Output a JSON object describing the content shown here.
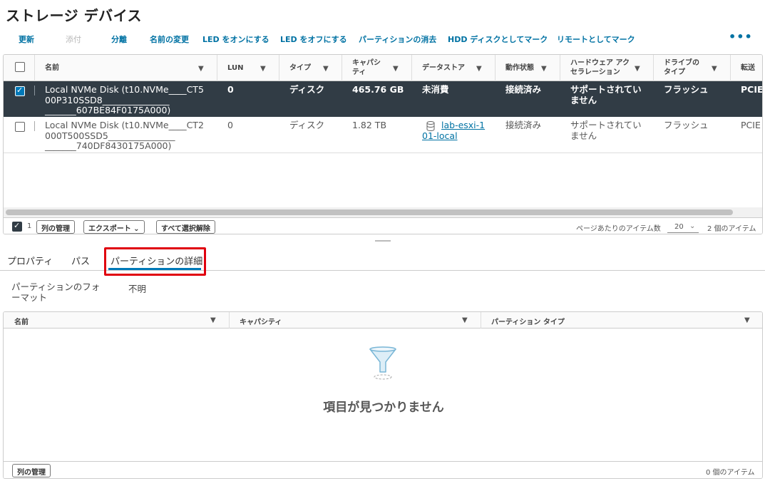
{
  "page": {
    "title": "ストレージ デバイス"
  },
  "toolbar": {
    "refresh": "更新",
    "attach": "添付",
    "detach": "分離",
    "rename": "名前の変更",
    "led_on": "LED をオンにする",
    "led_off": "LED をオフにする",
    "erase_partitions": "パーティションの消去",
    "mark_hdd": "HDD ディスクとしてマーク",
    "mark_remote": "リモートとしてマーク",
    "more": "•••"
  },
  "devices_grid": {
    "columns": {
      "name": "名前",
      "lun": "LUN",
      "type": "タイプ",
      "capacity_1": "キャパシ",
      "capacity_2": "ティ",
      "datastore": "データストア",
      "op_state": "動作状態",
      "hw_accel_1": "ハードウェア アク",
      "hw_accel_2": "セラレーション",
      "drive_type_1": "ドライブの",
      "drive_type_2": "タイプ",
      "transport": "転送"
    },
    "rows": [
      {
        "selected": true,
        "name_1": "Local NVMe Disk (t10.NVMe____CT5",
        "name_2": "00P310SSD8_______________",
        "name_3": "_______607BE84F0175A000)",
        "lun": "0",
        "type": "ディスク",
        "capacity": "465.76 GB",
        "datastore": "未消費",
        "op_state": "接続済み",
        "hw_accel_1": "サポートされてい",
        "hw_accel_2": "ません",
        "drive_type": "フラッシュ",
        "transport": "PCIE"
      },
      {
        "selected": false,
        "name_1": "Local NVMe Disk (t10.NVMe____CT2",
        "name_2": "000T500SSD5_______________",
        "name_3": "_______740DF8430175A000)",
        "lun": "0",
        "type": "ディスク",
        "capacity": "1.82 TB",
        "datastore_1": "lab-esxi-1",
        "datastore_2": "01-local",
        "op_state": "接続済み",
        "hw_accel_1": "サポートされてい",
        "hw_accel_2": "ません",
        "drive_type": "フラッシュ",
        "transport": "PCIE"
      }
    ],
    "footer": {
      "selected_count": "1",
      "manage_columns": "列の管理",
      "export": "エクスポート ⌄",
      "clear_selection": "すべて選択解除",
      "items_per_page_label": "ページあたりのアイテム数",
      "items_per_page": "20",
      "total": "2 個のアイテム"
    }
  },
  "tabs": {
    "properties": "プロパティ",
    "paths": "パス",
    "partition_details": "パーティションの詳細"
  },
  "partition": {
    "format_label_1": "パーティションのフォ",
    "format_label_2": "ーマット",
    "format_value": "不明"
  },
  "partitions_grid": {
    "columns": {
      "name": "名前",
      "capacity": "キャパシティ",
      "partition_type": "パーティション タイプ"
    },
    "empty_text": "項目が見つかりません",
    "footer": {
      "manage_columns": "列の管理",
      "total": "0 個のアイテム"
    }
  },
  "colors": {
    "accent": "#0079b8",
    "selected_row": "#313c45",
    "highlight": "#e0000e"
  }
}
